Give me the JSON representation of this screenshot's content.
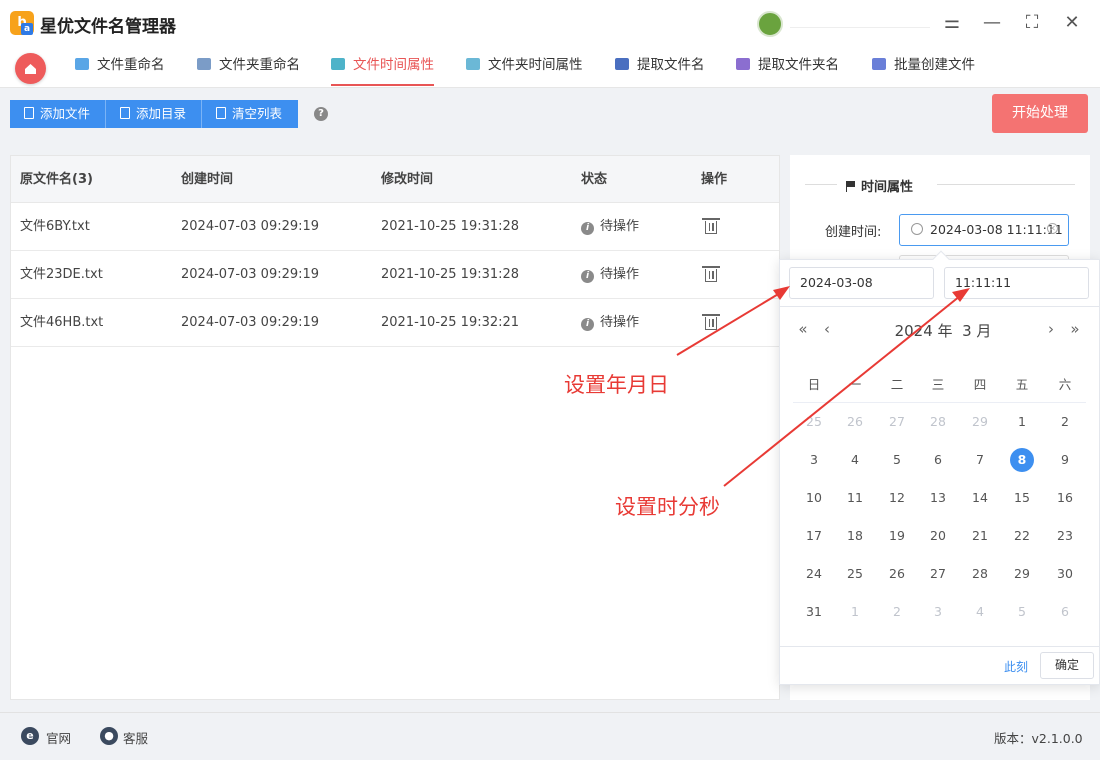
{
  "app": {
    "title": "星优文件名管理器",
    "logo_letters": "b",
    "logo_sub": "a"
  },
  "window_controls": {
    "settings": "⚌",
    "minimize": "—",
    "maximize": "⛶",
    "close": "✕"
  },
  "tabs": [
    {
      "label": "文件重命名",
      "active": false,
      "icon": "rename-icon"
    },
    {
      "label": "文件夹重命名",
      "active": false,
      "icon": "folder-rename-icon"
    },
    {
      "label": "文件时间属性",
      "active": true,
      "icon": "file-time-icon"
    },
    {
      "label": "文件夹时间属性",
      "active": false,
      "icon": "folder-time-icon"
    },
    {
      "label": "提取文件名",
      "active": false,
      "icon": "extract-filename-icon"
    },
    {
      "label": "提取文件夹名",
      "active": false,
      "icon": "extract-foldername-icon"
    },
    {
      "label": "批量创建文件",
      "active": false,
      "icon": "batch-create-icon"
    }
  ],
  "toolbar": {
    "add_file": "添加文件",
    "add_dir": "添加目录",
    "clear_list": "清空列表",
    "help": "?",
    "start": "开始处理"
  },
  "table": {
    "headers": [
      "原文件名(3)",
      "创建时间",
      "修改时间",
      "状态",
      "操作"
    ],
    "rows": [
      {
        "name": "文件6BY.txt",
        "created": "2024-07-03 09:29:19",
        "modified": "2021-10-25 19:31:28",
        "status": "待操作"
      },
      {
        "name": "文件23DE.txt",
        "created": "2024-07-03 09:29:19",
        "modified": "2021-10-25 19:31:28",
        "status": "待操作"
      },
      {
        "name": "文件46HB.txt",
        "created": "2024-07-03 09:29:19",
        "modified": "2021-10-25 19:32:21",
        "status": "待操作"
      }
    ]
  },
  "time_panel": {
    "section_title": "时间属性",
    "created_label": "创建时间:",
    "created_value": "2024-03-08 11:11:11"
  },
  "picker": {
    "date_value": "2024-03-08",
    "time_value": "11:11:11",
    "year_label": "2024 年",
    "month_label": "3 月",
    "weekdays": [
      "日",
      "一",
      "二",
      "三",
      "四",
      "五",
      "六"
    ],
    "days": [
      [
        "25",
        "26",
        "27",
        "28",
        "29",
        "1",
        "2"
      ],
      [
        "3",
        "4",
        "5",
        "6",
        "7",
        "8",
        "9"
      ],
      [
        "10",
        "11",
        "12",
        "13",
        "14",
        "15",
        "16"
      ],
      [
        "17",
        "18",
        "19",
        "20",
        "21",
        "22",
        "23"
      ],
      [
        "24",
        "25",
        "26",
        "27",
        "28",
        "29",
        "30"
      ],
      [
        "31",
        "1",
        "2",
        "3",
        "4",
        "5",
        "6"
      ]
    ],
    "selected_day": "8",
    "now_label": "此刻",
    "ok_label": "确定"
  },
  "annotations": {
    "set_date": "设置年月日",
    "set_time": "设置时分秒"
  },
  "footer": {
    "website": "官网",
    "service": "客服",
    "version": "版本：v2.1.0.0"
  },
  "colors": {
    "accent": "#e85555",
    "primary": "#3d8ff0",
    "start": "#f47372",
    "annotation": "#e83a35"
  }
}
